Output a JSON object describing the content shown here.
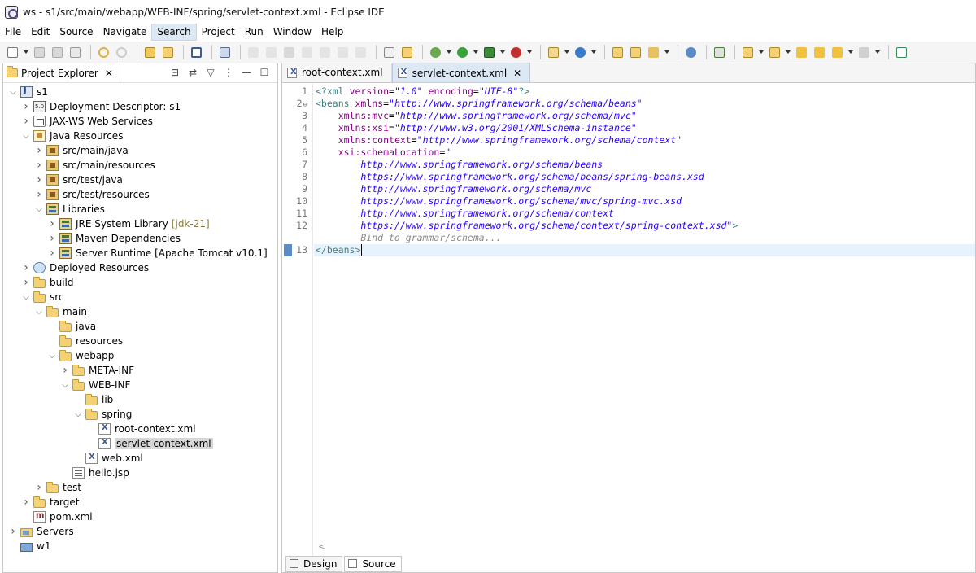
{
  "window": {
    "title": "ws - s1/src/main/webapp/WEB-INF/spring/servlet-context.xml - Eclipse IDE"
  },
  "menu": [
    "File",
    "Edit",
    "Source",
    "Navigate",
    "Search",
    "Project",
    "Run",
    "Window",
    "Help"
  ],
  "menu_active": "Search",
  "project_explorer": {
    "tab_label": "Project Explorer",
    "close_glyph": "✕",
    "tree": [
      {
        "label": "s1",
        "icon": "project",
        "depth": 0,
        "twisty": "open"
      },
      {
        "label": "Deployment Descriptor: s1",
        "icon": "deployment-descriptor",
        "depth": 1,
        "twisty": "closed"
      },
      {
        "label": "JAX-WS Web Services",
        "icon": "web-services",
        "depth": 1,
        "twisty": "closed"
      },
      {
        "label": "Java Resources",
        "icon": "java-resources",
        "depth": 1,
        "twisty": "open"
      },
      {
        "label": "src/main/java",
        "icon": "source-folder",
        "depth": 2,
        "twisty": "closed"
      },
      {
        "label": "src/main/resources",
        "icon": "source-folder",
        "depth": 2,
        "twisty": "closed"
      },
      {
        "label": "src/test/java",
        "icon": "source-folder",
        "depth": 2,
        "twisty": "closed"
      },
      {
        "label": "src/test/resources",
        "icon": "source-folder",
        "depth": 2,
        "twisty": "closed"
      },
      {
        "label": "Libraries",
        "icon": "libraries",
        "depth": 2,
        "twisty": "open"
      },
      {
        "label": "JRE System Library",
        "decoration": "[jdk-21]",
        "icon": "library",
        "depth": 3,
        "twisty": "closed"
      },
      {
        "label": "Maven Dependencies",
        "icon": "library",
        "depth": 3,
        "twisty": "closed"
      },
      {
        "label": "Server Runtime [Apache Tomcat v10.1]",
        "icon": "library",
        "depth": 3,
        "twisty": "closed"
      },
      {
        "label": "Deployed Resources",
        "icon": "deployed-resources",
        "depth": 1,
        "twisty": "closed"
      },
      {
        "label": "build",
        "icon": "folder",
        "depth": 1,
        "twisty": "closed"
      },
      {
        "label": "src",
        "icon": "folder",
        "depth": 1,
        "twisty": "open"
      },
      {
        "label": "main",
        "icon": "folder",
        "depth": 2,
        "twisty": "open"
      },
      {
        "label": "java",
        "icon": "folder",
        "depth": 3,
        "twisty": "none"
      },
      {
        "label": "resources",
        "icon": "folder",
        "depth": 3,
        "twisty": "none"
      },
      {
        "label": "webapp",
        "icon": "folder",
        "depth": 3,
        "twisty": "open"
      },
      {
        "label": "META-INF",
        "icon": "folder",
        "depth": 4,
        "twisty": "closed"
      },
      {
        "label": "WEB-INF",
        "icon": "folder",
        "depth": 4,
        "twisty": "open"
      },
      {
        "label": "lib",
        "icon": "folder",
        "depth": 5,
        "twisty": "none"
      },
      {
        "label": "spring",
        "icon": "folder",
        "depth": 5,
        "twisty": "open"
      },
      {
        "label": "root-context.xml",
        "icon": "xml-file",
        "depth": 6,
        "twisty": "none"
      },
      {
        "label": "servlet-context.xml",
        "icon": "xml-file",
        "depth": 6,
        "twisty": "none",
        "selected": true
      },
      {
        "label": "web.xml",
        "icon": "xml-file",
        "depth": 5,
        "twisty": "none"
      },
      {
        "label": "hello.jsp",
        "icon": "jsp-file",
        "depth": 4,
        "twisty": "none"
      },
      {
        "label": "test",
        "icon": "folder",
        "depth": 2,
        "twisty": "closed"
      },
      {
        "label": "target",
        "icon": "folder",
        "depth": 1,
        "twisty": "closed"
      },
      {
        "label": "pom.xml",
        "icon": "pom-file",
        "depth": 1,
        "twisty": "none"
      },
      {
        "label": "Servers",
        "icon": "servers-folder",
        "depth": 0,
        "twisty": "closed"
      },
      {
        "label": "w1",
        "icon": "project-folder",
        "depth": 0,
        "twisty": "none"
      }
    ]
  },
  "editor": {
    "tabs": [
      {
        "label": "root-context.xml",
        "active": false
      },
      {
        "label": "servlet-context.xml",
        "active": true
      }
    ],
    "lines": [
      {
        "n": "1",
        "text": "<?xml version=\"1.0\" encoding=\"UTF-8\"?>"
      },
      {
        "n": "2",
        "text": "<beans xmlns=\"http://www.springframework.org/schema/beans\""
      },
      {
        "n": "3",
        "text": "    xmlns:mvc=\"http://www.springframework.org/schema/mvc\""
      },
      {
        "n": "4",
        "text": "    xmlns:xsi=\"http://www.w3.org/2001/XMLSchema-instance\""
      },
      {
        "n": "5",
        "text": "    xmlns:context=\"http://www.springframework.org/schema/context\""
      },
      {
        "n": "6",
        "text": "    xsi:schemaLocation=\""
      },
      {
        "n": "7",
        "text": "        http://www.springframework.org/schema/beans"
      },
      {
        "n": "8",
        "text": "        https://www.springframework.org/schema/beans/spring-beans.xsd"
      },
      {
        "n": "9",
        "text": "        http://www.springframework.org/schema/mvc"
      },
      {
        "n": "10",
        "text": "        https://www.springframework.org/schema/mvc/spring-mvc.xsd"
      },
      {
        "n": "11",
        "text": "        http://www.springframework.org/schema/context"
      },
      {
        "n": "12",
        "text": "        https://www.springframework.org/schema/context/spring-context.xsd\">"
      },
      {
        "n": "",
        "text": "        Bind to grammar/schema..."
      },
      {
        "n": "13",
        "text": "</beans>"
      }
    ],
    "bottom_tabs": [
      {
        "label": "Design",
        "active": false
      },
      {
        "label": "Source",
        "active": true
      }
    ]
  }
}
